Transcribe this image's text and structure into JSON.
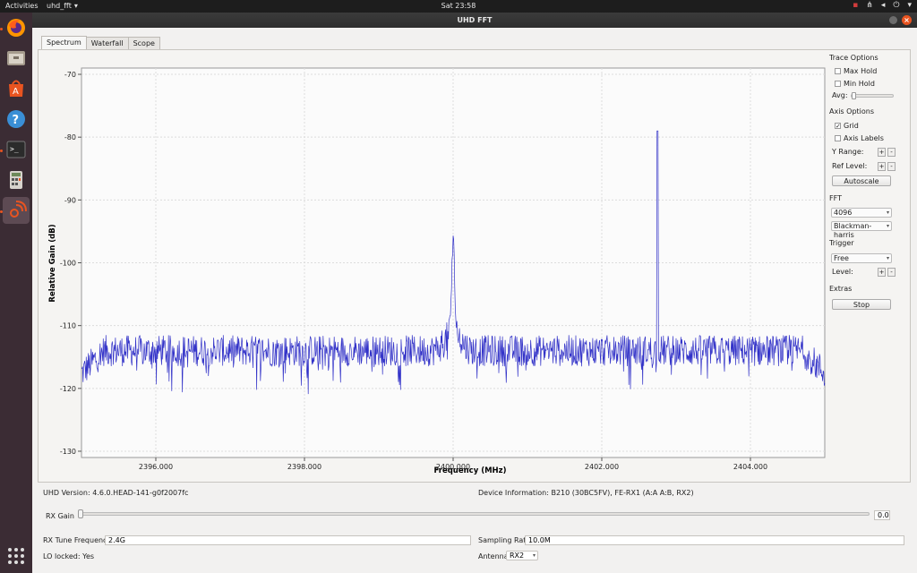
{
  "topbar": {
    "activities": "Activities",
    "app_name": "uhd_fft",
    "clock": "Sat 23:58"
  },
  "window": {
    "title": "UHD FFT"
  },
  "tabs": [
    {
      "label": "Spectrum"
    },
    {
      "label": "Waterfall"
    },
    {
      "label": "Scope"
    }
  ],
  "sidebar": {
    "trace_options": "Trace Options",
    "max_hold": "Max Hold",
    "min_hold": "Min Hold",
    "avg": "Avg:",
    "axis_options": "Axis Options",
    "grid": "Grid",
    "grid_checked": true,
    "axis_labels": "Axis Labels",
    "y_range": "Y Range:",
    "ref_level": "Ref Level:",
    "autoscale": "Autoscale",
    "fft": "FFT",
    "fft_size": "4096",
    "window_fn": "Blackman-harris",
    "trigger": "Trigger",
    "trigger_mode": "Free",
    "level": "Level:",
    "extras": "Extras",
    "stop": "Stop",
    "plus": "+",
    "minus": "-"
  },
  "bottom": {
    "uhd_version": "UHD Version: 4.6.0.HEAD-141-g0f2007fc",
    "device_info": "Device Information: B210 (30BC5FV), FE-RX1 (A:A A:B, RX2)",
    "rx_gain_label": "RX Gain",
    "rx_gain_value": "0.0",
    "rx_tune_label": "RX Tune Frequency:",
    "rx_tune_value": "2.4G",
    "sampling_label": "Sampling Rate:",
    "sampling_value": "10.0M",
    "lo_locked": "LO locked: Yes",
    "antenna_label": "Antenna:",
    "antenna_value": "RX2"
  },
  "chart_data": {
    "type": "line",
    "xlabel": "Frequency (MHz)",
    "ylabel": "Relative Gain (dB)",
    "xlim": [
      2395.0,
      2405.0
    ],
    "ylim": [
      -131,
      -69
    ],
    "xticks": [
      "2396.000",
      "2398.000",
      "2400.000",
      "2402.000",
      "2404.000"
    ],
    "xtick_values": [
      2396,
      2398,
      2400,
      2402,
      2404
    ],
    "yticks": [
      "-70",
      "-80",
      "-90",
      "-100",
      "-110",
      "-120",
      "-130"
    ],
    "ytick_values": [
      -70,
      -80,
      -90,
      -100,
      -110,
      -120,
      -130
    ],
    "grid": true,
    "line_color": "#3232c8",
    "noise_floor": -114,
    "peaks": [
      {
        "x": 2400.0,
        "y": -100.5
      },
      {
        "x": 2402.75,
        "y": -79
      }
    ]
  },
  "colors": {
    "accent": "#e95420",
    "trace": "#3232c8"
  }
}
